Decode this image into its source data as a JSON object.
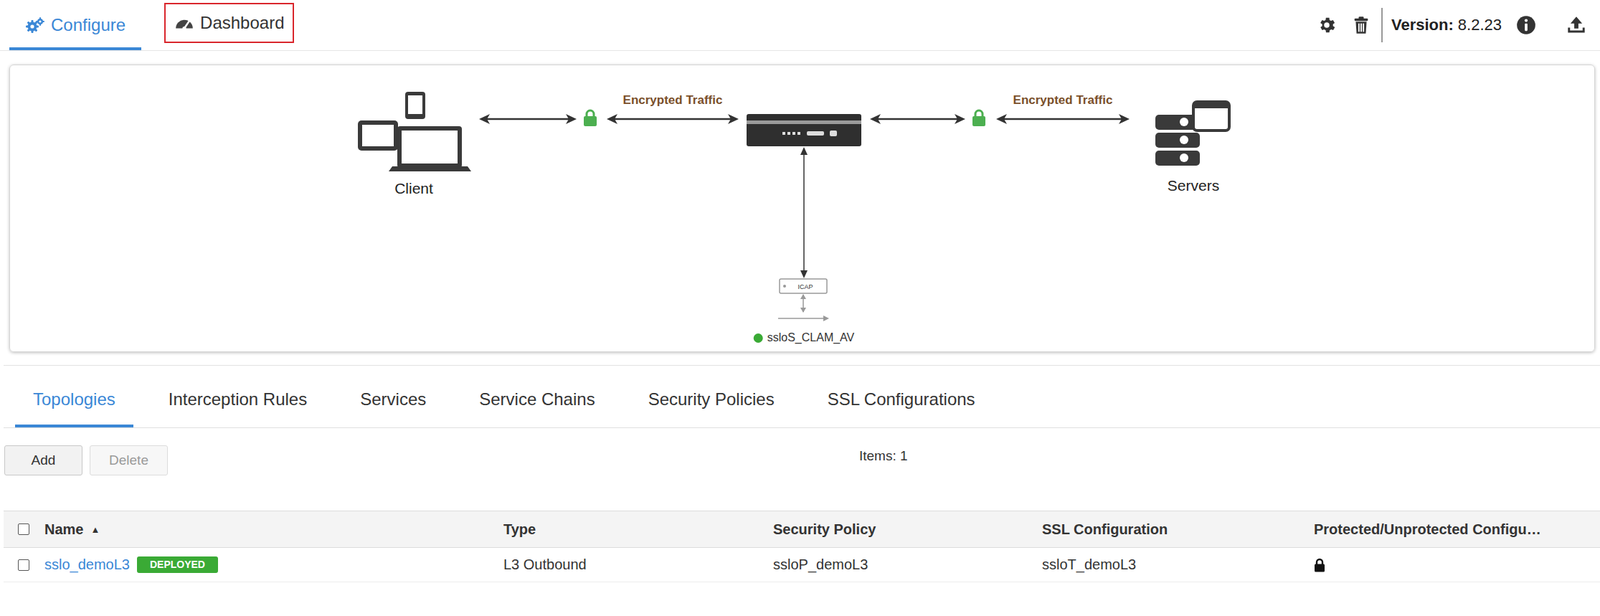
{
  "header": {
    "tabs": [
      {
        "label": "Configure",
        "selected": true,
        "highlighted": false
      },
      {
        "label": "Dashboard",
        "selected": false,
        "highlighted": true
      }
    ],
    "version_label": "Version:",
    "version": "8.2.23"
  },
  "diagram": {
    "client_label": "Client",
    "servers_label": "Servers",
    "left_link": "Encrypted Traffic",
    "right_link": "Encrypted Traffic",
    "service": {
      "name": "ssloS_CLAM_AV",
      "box_label": "ICAP",
      "color": "#3aaa35"
    }
  },
  "tabs": [
    {
      "label": "Topologies",
      "selected": true
    },
    {
      "label": "Interception Rules",
      "selected": false
    },
    {
      "label": "Services",
      "selected": false
    },
    {
      "label": "Service Chains",
      "selected": false
    },
    {
      "label": "Security Policies",
      "selected": false
    },
    {
      "label": "SSL Configurations",
      "selected": false
    }
  ],
  "toolbar": {
    "buttons": [
      {
        "label": "Add",
        "disabled": false
      },
      {
        "label": "Delete",
        "disabled": true
      }
    ],
    "items_count": "Items: 1"
  },
  "table": {
    "all_selected": false,
    "columns": [
      {
        "label": "Name",
        "sort": "▲"
      },
      {
        "label": "Type",
        "sort": ""
      },
      {
        "label": "Security Policy",
        "sort": ""
      },
      {
        "label": "SSL Configuration",
        "sort": ""
      },
      {
        "label": "Protected/Unprotected Configu…",
        "sort": ""
      }
    ],
    "rows": [
      {
        "name": "sslo_demoL3",
        "badge": "DEPLOYED",
        "selected": false,
        "type": "L3 Outbound",
        "security_policy": "ssloP_demoL3",
        "ssl_configuration": "ssloT_demoL3",
        "protected": true
      }
    ]
  }
}
